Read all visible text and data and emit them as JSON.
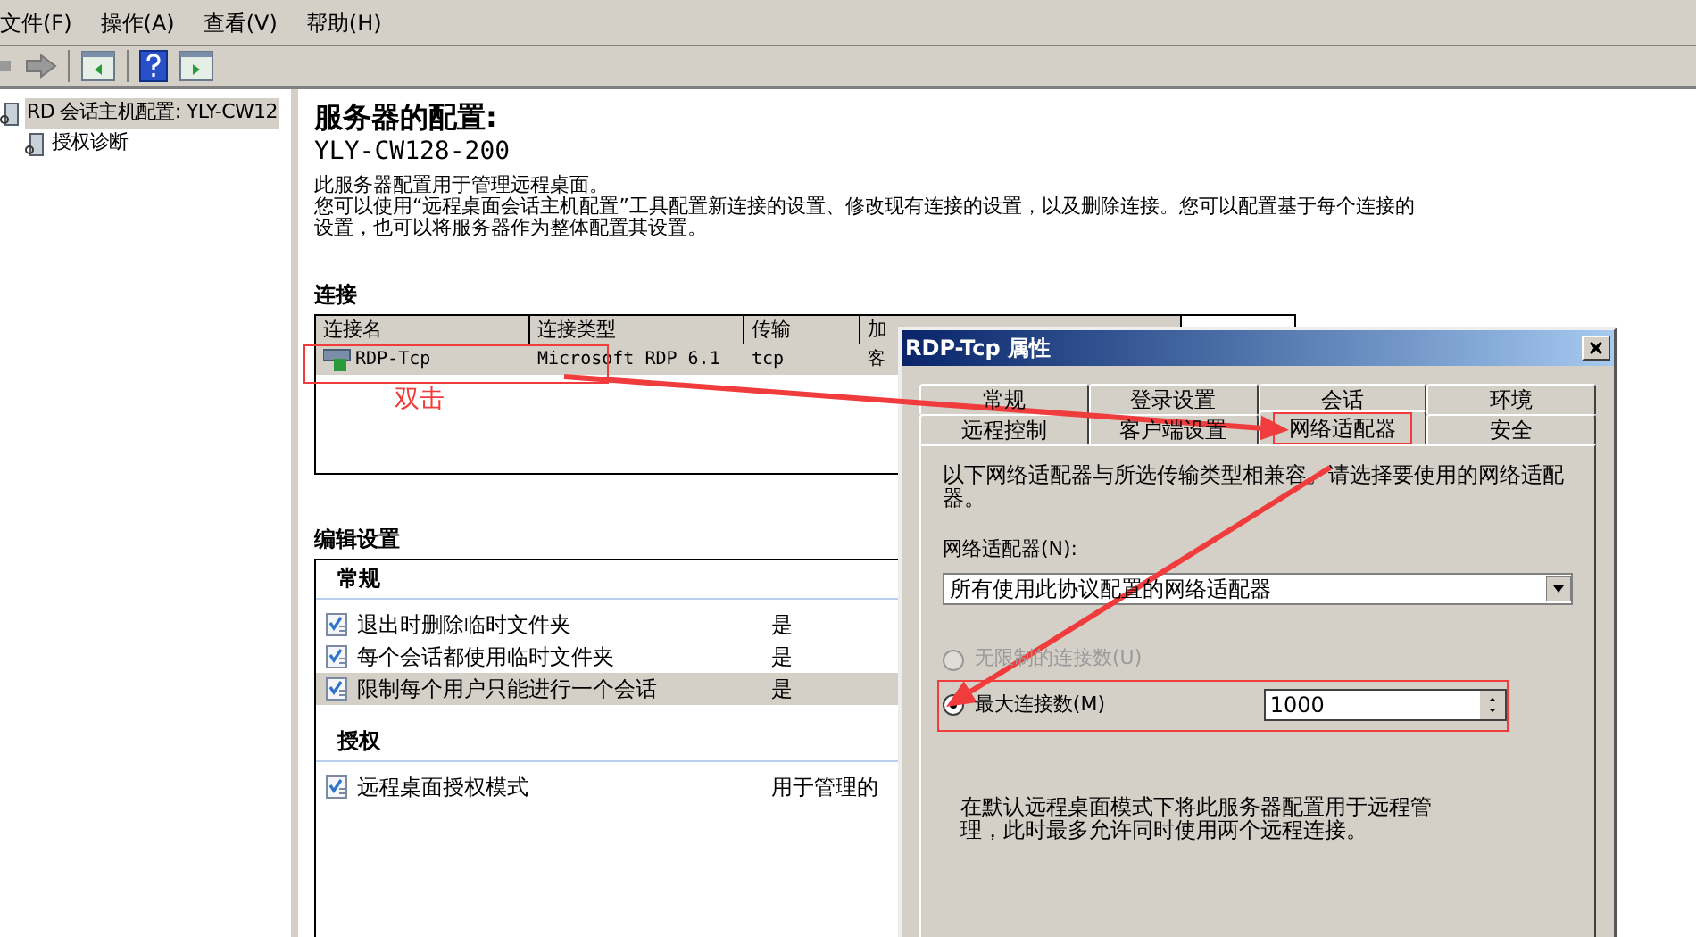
{
  "menu": [
    "文件(F)",
    "操作(A)",
    "查看(V)",
    "帮助(H)"
  ],
  "tree": [
    {
      "label": "RD 会话主机配置: YLY-CW12",
      "selected": true,
      "children": [
        {
          "label": "授权诊断",
          "selected": false
        }
      ]
    }
  ],
  "main": {
    "title": "服务器的配置:",
    "server": "YLY-CW128-200",
    "description": [
      "此服务器配置用于管理远程桌面。",
      "您可以使用“远程桌面会话主机配置”工具配置新连接的设置、修改现有连接的设置，以及删除连接。您可以配置基于每个连接的设置，也可以将服务器作为整体配置其设置。"
    ],
    "connections": {
      "heading": "连接",
      "columns": [
        "连接名",
        "连接类型",
        "传输",
        "加"
      ],
      "rows": [
        {
          "cells": [
            "RDP-Tcp",
            "Microsoft RDP 6.1",
            "tcp",
            "客"
          ],
          "selected": true
        }
      ]
    },
    "settings": {
      "heading": "编辑设置",
      "groups": [
        {
          "title": "常规",
          "items": [
            {
              "name": "退出时删除临时文件夹",
              "value": "是",
              "selected": false
            },
            {
              "name": "每个会话都使用临时文件夹",
              "value": "是",
              "selected": false
            },
            {
              "name": "限制每个用户只能进行一个会话",
              "value": "是",
              "selected": true
            }
          ]
        },
        {
          "title": "授权",
          "items": [
            {
              "name": "远程桌面授权模式",
              "value": "用于管理的",
              "selected": false
            }
          ]
        }
      ]
    }
  },
  "annotation": {
    "label": "双击"
  },
  "dialog": {
    "title": "RDP-Tcp 属性",
    "tab_rows": [
      [
        {
          "label": "常规",
          "selected": false
        },
        {
          "label": "登录设置",
          "selected": false
        },
        {
          "label": "会话",
          "selected": false
        },
        {
          "label": "环境",
          "selected": false
        }
      ],
      [
        {
          "label": "远程控制",
          "selected": false
        },
        {
          "label": "客户端设置",
          "selected": false
        },
        {
          "label": "网络适配器",
          "selected": true
        },
        {
          "label": "安全",
          "selected": false
        }
      ]
    ],
    "intro": "以下网络适配器与所选传输类型相兼容。请选择要使用的网络适配器。",
    "adapter_label": "网络适配器(N):",
    "adapter_value": "所有使用此协议配置的网络适配器",
    "options": [
      {
        "label": "无限制的连接数(U)",
        "selected": false,
        "disabled": true
      },
      {
        "label": "最大连接数(M)",
        "selected": true,
        "disabled": false
      }
    ],
    "max_value": "1000",
    "note": "在默认远程桌面模式下将此服务器配置用于远程管理，此时最多允许同时使用两个远程连接。"
  }
}
